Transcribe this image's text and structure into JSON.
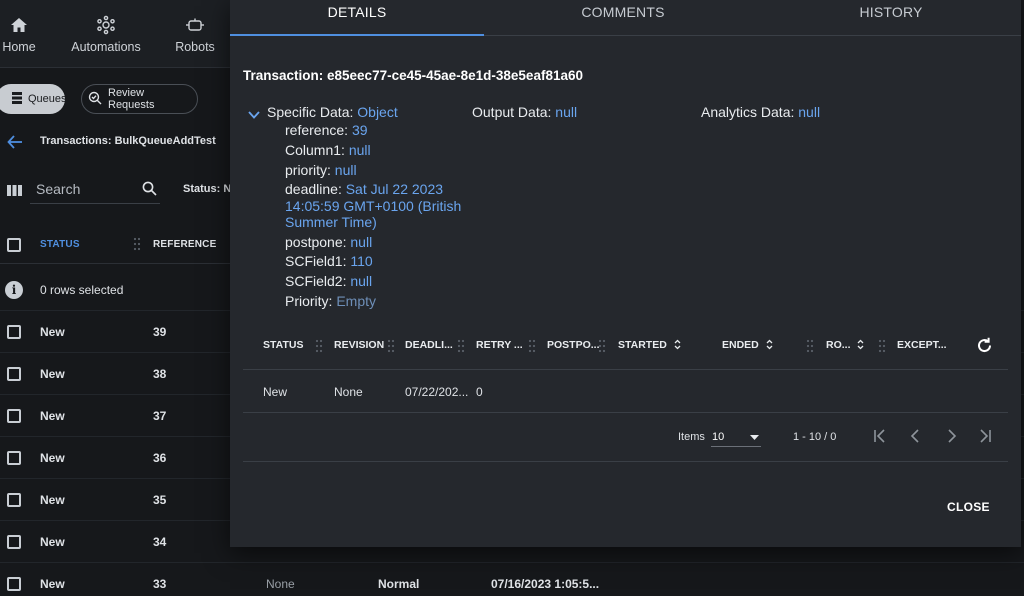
{
  "nav": {
    "home": "Home",
    "automations": "Automations",
    "robots": "Robots"
  },
  "chips": {
    "queues": "Queues",
    "review": "Review Requests"
  },
  "page": {
    "title": "Transactions: BulkQueueAddTest",
    "search_placeholder": "Search",
    "status_filter": "Status: N"
  },
  "list": {
    "headers": {
      "status": "STATUS",
      "reference": "REFERENCE"
    },
    "selected_text": "0 rows selected",
    "rows": [
      {
        "status": "New",
        "reference": "39"
      },
      {
        "status": "New",
        "reference": "38"
      },
      {
        "status": "New",
        "reference": "37"
      },
      {
        "status": "New",
        "reference": "36"
      },
      {
        "status": "New",
        "reference": "35"
      },
      {
        "status": "New",
        "reference": "34"
      },
      {
        "status": "New",
        "reference": "33",
        "revision": "None",
        "priority": "Normal",
        "deadline": "07/16/2023 1:05:5..."
      }
    ]
  },
  "dialog": {
    "tabs": [
      "DETAILS",
      "COMMENTS",
      "HISTORY"
    ],
    "transaction_title": "Transaction: e85eec77-ce45-45ae-8e1d-38e5eaf81a60",
    "specific_data": {
      "label": "Specific Data:",
      "value": "Object",
      "fields": [
        {
          "key": "reference:",
          "value": "39"
        },
        {
          "key": "Column1:",
          "value": "null"
        },
        {
          "key": "priority:",
          "value": "null"
        },
        {
          "key": "deadline:",
          "value_line1": "Sat Jul 22 2023",
          "value_line2": "14:05:59 GMT+0100 (British",
          "value_line3": "Summer Time)"
        },
        {
          "key": "postpone:",
          "value": "null"
        },
        {
          "key": "SCField1:",
          "value": "110"
        },
        {
          "key": "SCField2:",
          "value": "null"
        },
        {
          "key": "Priority:",
          "value": "Empty"
        }
      ]
    },
    "output_data": {
      "label": "Output Data:",
      "value": "null"
    },
    "analytics_data": {
      "label": "Analytics Data:",
      "value": "null"
    },
    "history_table": {
      "headers": [
        "STATUS",
        "REVISION",
        "DEADLI...",
        "RETRY ...",
        "POSTPO...",
        "STARTED",
        "ENDED",
        "RO...",
        "EXCEPT..."
      ],
      "row": [
        "New",
        "None",
        "07/22/202...",
        "0"
      ]
    },
    "pager": {
      "items_label": "Items",
      "items_value": "10",
      "range": "1 - 10 / 0"
    },
    "close_label": "CLOSE"
  },
  "colors": {
    "accent": "#4f8fe0",
    "link_value": "#6aa5ef",
    "dialog_bg": "#25282d",
    "app_bg": "#16181b"
  }
}
